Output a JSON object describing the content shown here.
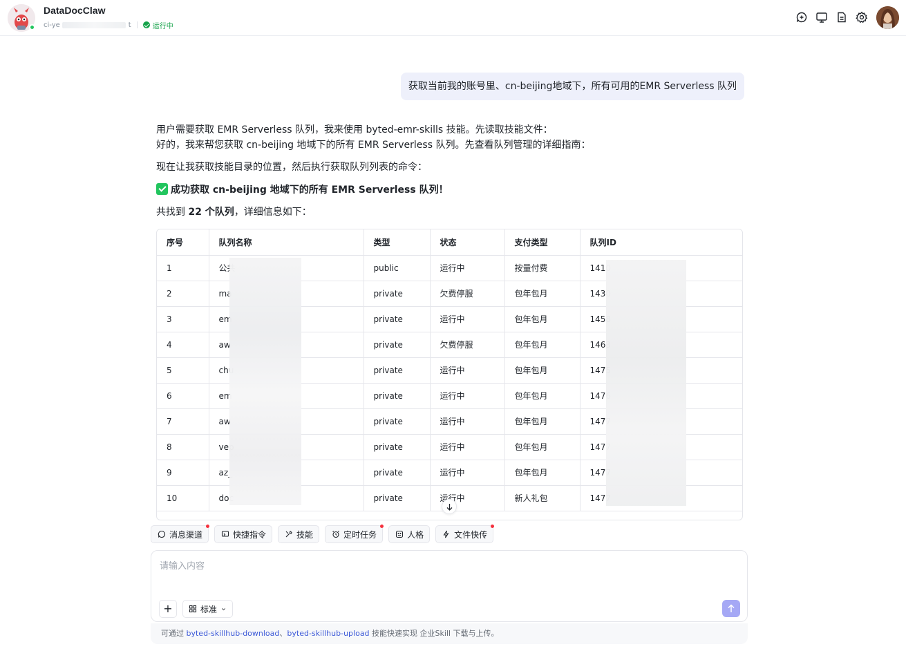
{
  "header": {
    "title": "DataDocClaw",
    "account_prefix": "ci-ye",
    "account_suffix": "t",
    "status": "运行中"
  },
  "conversation": {
    "user_message": "获取当前我的账号里、cn-beijing地域下，所有可用的EMR Serverless 队列",
    "line1": "用户需要获取 EMR Serverless 队列，我来使用 byted-emr-skills 技能。先读取技能文件：",
    "line2": "好的，我来帮您获取 cn-beijing 地域下的所有 EMR Serverless 队列。先查看队列管理的详细指南：",
    "line3": "现在让我获取技能目录的位置，然后执行获取队列列表的命令：",
    "success_title": "成功获取 cn-beijing 地域下的所有 EMR Serverless 队列！",
    "found_prefix": "共找到 ",
    "found_count": "22 个队列",
    "found_suffix": "，详细信息如下："
  },
  "table": {
    "headers": [
      "序号",
      "队列名称",
      "类型",
      "状态",
      "支付类型",
      "队列ID"
    ],
    "rows": [
      [
        "1",
        "公共",
        "public",
        "运行中",
        "按量付费",
        "1410"
      ],
      [
        "2",
        "ma",
        "private",
        "欠费停服",
        "包年包月",
        "1430"
      ],
      [
        "3",
        "em",
        "private",
        "运行中",
        "包年包月",
        "1458"
      ],
      [
        "4",
        "aw",
        "private",
        "欠费停服",
        "包年包月",
        "1463"
      ],
      [
        "5",
        "chu",
        "private",
        "运行中",
        "包年包月",
        "1475"
      ],
      [
        "6",
        "em",
        "private",
        "运行中",
        "包年包月",
        "1476"
      ],
      [
        "7",
        "aw",
        "private",
        "运行中",
        "包年包月",
        "1477"
      ],
      [
        "8",
        "vep",
        "private",
        "运行中",
        "包年包月",
        "1477"
      ],
      [
        "9",
        "az_",
        "private",
        "运行中",
        "包年包月",
        "1477"
      ],
      [
        "10",
        "doc",
        "private",
        "运行中",
        "新人礼包",
        "1477"
      ]
    ]
  },
  "toolbar": {
    "chips": [
      "消息渠道",
      "快捷指令",
      "技能",
      "定时任务",
      "人格",
      "文件快传"
    ]
  },
  "input": {
    "placeholder": "请输入内容",
    "mode": "标准"
  },
  "footer": {
    "prefix": "可通过 ",
    "link1": "byted-skillhub-download",
    "sep": "、",
    "link2": "byted-skillhub-upload",
    "suffix": " 技能快速实现 企业Skill 下载与上传。"
  }
}
